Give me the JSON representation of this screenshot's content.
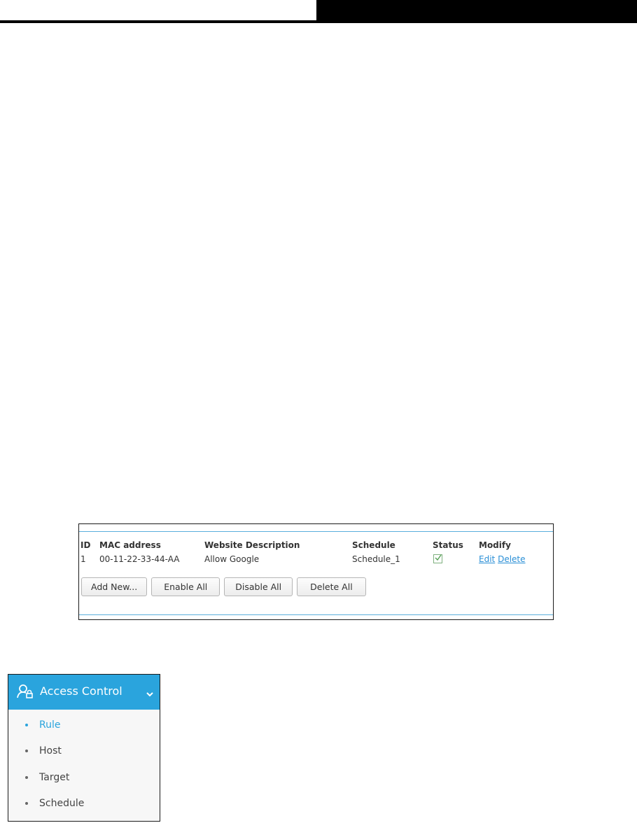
{
  "rule_table": {
    "headers": {
      "id": "ID",
      "mac": "MAC address",
      "description": "Website Description",
      "schedule": "Schedule",
      "status": "Status",
      "modify": "Modify"
    },
    "rows": [
      {
        "id": "1",
        "mac": "00-11-22-33-44-AA",
        "description": "Allow Google",
        "schedule": "Schedule_1",
        "status_enabled": true,
        "edit_label": "Edit",
        "delete_label": "Delete"
      }
    ],
    "buttons": {
      "add_new": "Add New...",
      "enable_all": "Enable All",
      "disable_all": "Disable All",
      "delete_all": "Delete All"
    }
  },
  "menu": {
    "title": "Access Control",
    "icon": "user-lock-icon",
    "accent_color": "#2aa4dd",
    "items": [
      {
        "label": "Rule",
        "active": true
      },
      {
        "label": "Host",
        "active": false
      },
      {
        "label": "Target",
        "active": false
      },
      {
        "label": "Schedule",
        "active": false
      }
    ]
  }
}
